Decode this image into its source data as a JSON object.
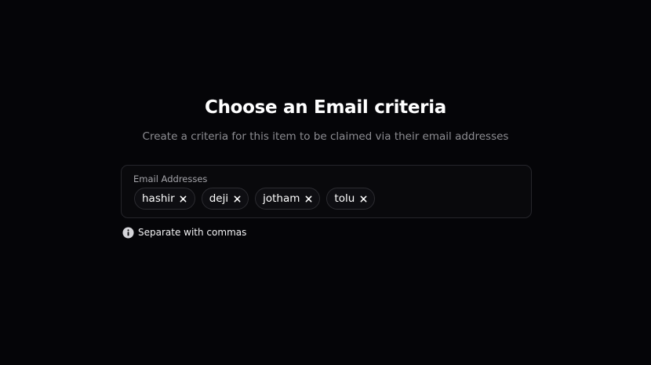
{
  "header": {
    "title": "Choose an Email criteria",
    "subtitle": "Create a criteria for this item to be claimed via their email addresses"
  },
  "email_field": {
    "label": "Email Addresses",
    "chips": [
      {
        "label": "hashir",
        "remove_icon": "close-icon"
      },
      {
        "label": "deji",
        "remove_icon": "close-icon"
      },
      {
        "label": "jotham",
        "remove_icon": "close-icon"
      },
      {
        "label": "tolu",
        "remove_icon": "close-icon"
      }
    ]
  },
  "hint": {
    "icon": "info-icon",
    "text": "Separate with commas"
  },
  "colors": {
    "background": "#050508",
    "field_border": "#26262b",
    "muted_text": "#8d8d92"
  }
}
